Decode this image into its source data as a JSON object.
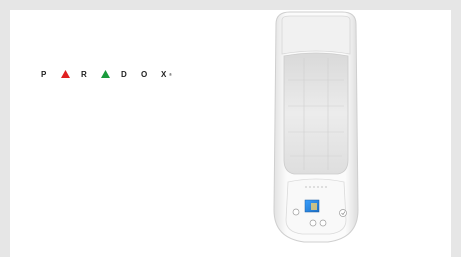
{
  "logo": {
    "letters": [
      "P",
      "A",
      "R",
      "A",
      "D",
      "O",
      "X"
    ],
    "registered_mark": "®",
    "accent_red": "#e02020",
    "accent_green": "#1a9b3c"
  },
  "device": {
    "brand_text": "PARADOX",
    "name": "motion-detector",
    "screen_color": "#2f8fe0",
    "body_color": "#f6f6f6"
  }
}
